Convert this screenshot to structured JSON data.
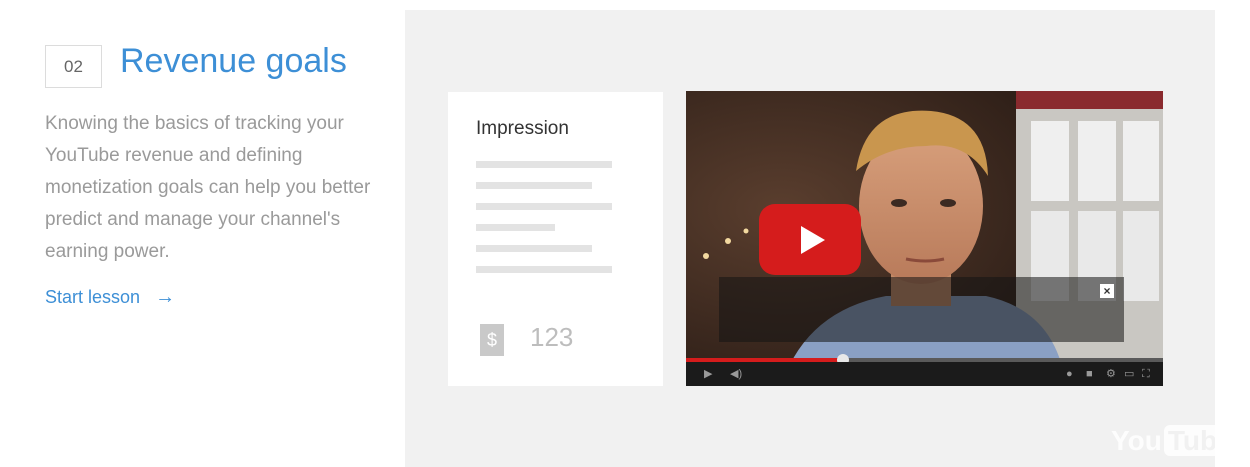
{
  "lesson": {
    "number": "02",
    "title": "Revenue goals",
    "description": "Knowing the basics of tracking your YouTube revenue and defining monetization goals can help you better predict and manage your channel's earning power.",
    "cta_label": "Start lesson",
    "cta_arrow": "→"
  },
  "card": {
    "title": "Impression",
    "currency_symbol": "$",
    "amount": "123"
  },
  "video": {
    "overlay_close": "×",
    "progress": 0.33,
    "controls": {
      "play": "▶",
      "volume": "◀)",
      "settings_icons": [
        "●",
        "■",
        "⚙",
        "▭",
        "⛶"
      ]
    }
  },
  "brand": {
    "you": "You",
    "tube": "Tube"
  },
  "colors": {
    "accent": "#3d8fd6",
    "play_red": "#d51c1c",
    "muted_text": "#9a9a9a"
  }
}
